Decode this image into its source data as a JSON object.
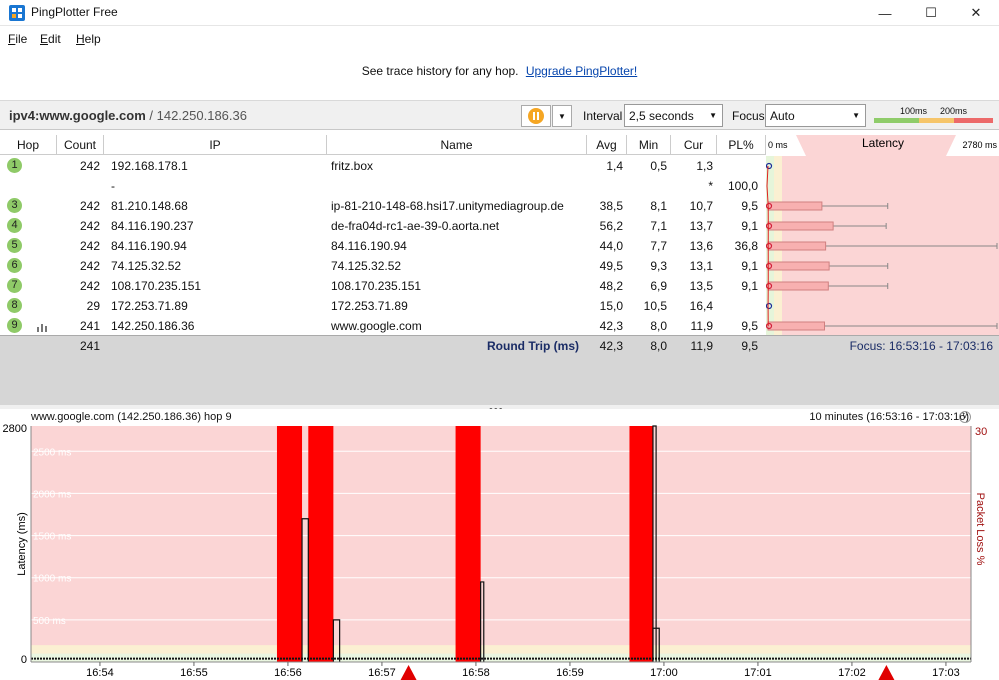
{
  "window": {
    "title": "PingPlotter Free",
    "minimize_glyph": "—",
    "maximize_glyph": "☐",
    "close_glyph": "✕"
  },
  "menu": {
    "file_hotkey": "F",
    "file_rest": "ile",
    "edit_hotkey": "E",
    "edit_rest": "dit",
    "help_hotkey": "H",
    "help_rest": "elp"
  },
  "promo": {
    "text": "See trace history for any hop.",
    "link": "Upgrade PingPlotter!"
  },
  "target": {
    "host": "ipv4:www.google.com",
    "separator": " / ",
    "ip": "142.250.186.36"
  },
  "controls": {
    "interval_label": "Interval",
    "interval_value": "2,5 seconds",
    "focus_label": "Focus",
    "focus_value": "Auto",
    "scale_100": "100ms",
    "scale_200": "200ms"
  },
  "colors": {
    "good": "#8fcc6a",
    "warn": "#f6c56a",
    "bad": "#ec6a6a",
    "latency_bg": "#fbd5d5",
    "loss_red": "#ff0000",
    "hop_green": "#8fca68"
  },
  "table": {
    "headers": [
      "Hop",
      "Count",
      "IP",
      "Name",
      "Avg",
      "Min",
      "Cur",
      "PL%"
    ],
    "latency_header": "Latency",
    "latency_min": "0 ms",
    "latency_max": "2780 ms",
    "rows": [
      {
        "hop": "1",
        "count": "242",
        "ip": "192.168.178.1",
        "name": "fritz.box",
        "avg": "1,4",
        "min": "0,5",
        "cur": "1,3",
        "pl": "",
        "box_avg": 1.4,
        "box_min": 0.5,
        "box_max": 1.4,
        "loss": 0
      },
      {
        "hop": "",
        "count": "",
        "ip": "-",
        "name": "",
        "avg": "",
        "min": "",
        "cur": "*",
        "pl": "100,0",
        "box_avg": null,
        "box_min": null,
        "box_max": null,
        "loss": 100
      },
      {
        "hop": "3",
        "count": "242",
        "ip": "81.210.148.68",
        "name": "ip-81-210-148-68.hsi17.unitymediagroup.de",
        "avg": "38,5",
        "min": "8,1",
        "cur": "10,7",
        "pl": "9,5",
        "box_avg": 38.5,
        "box_min": 8.1,
        "box_max": 760,
        "loss": 9.5
      },
      {
        "hop": "4",
        "count": "242",
        "ip": "84.116.190.237",
        "name": "de-fra04d-rc1-ae-39-0.aorta.net",
        "avg": "56,2",
        "min": "7,1",
        "cur": "13,7",
        "pl": "9,1",
        "box_avg": 56.2,
        "box_min": 7.1,
        "box_max": 740,
        "loss": 9.1
      },
      {
        "hop": "5",
        "count": "242",
        "ip": "84.116.190.94",
        "name": "84.116.190.94",
        "avg": "44,0",
        "min": "7,7",
        "cur": "13,6",
        "pl": "36,8",
        "box_avg": 44.0,
        "box_min": 7.7,
        "box_max": 2780,
        "loss": 36.8
      },
      {
        "hop": "6",
        "count": "242",
        "ip": "74.125.32.52",
        "name": "74.125.32.52",
        "avg": "49,5",
        "min": "9,3",
        "cur": "13,1",
        "pl": "9,1",
        "box_avg": 49.5,
        "box_min": 9.3,
        "box_max": 760,
        "loss": 9.1
      },
      {
        "hop": "7",
        "count": "242",
        "ip": "108.170.235.151",
        "name": "108.170.235.151",
        "avg": "48,2",
        "min": "6,9",
        "cur": "13,5",
        "pl": "9,1",
        "box_avg": 48.2,
        "box_min": 6.9,
        "box_max": 760,
        "loss": 9.1
      },
      {
        "hop": "8",
        "count": "29",
        "ip": "172.253.71.89",
        "name": "172.253.71.89",
        "avg": "15,0",
        "min": "10,5",
        "cur": "16,4",
        "pl": "",
        "box_avg": 15.0,
        "box_min": 10.5,
        "box_max": 16.4,
        "loss": 0
      },
      {
        "hop": "9",
        "count": "241",
        "ip": "142.250.186.36",
        "name": "www.google.com",
        "avg": "42,3",
        "min": "8,0",
        "cur": "11,9",
        "pl": "9,5",
        "box_avg": 42.3,
        "box_min": 8.0,
        "box_max": 2780,
        "loss": 9.5
      }
    ],
    "summary": {
      "count": "241",
      "label": "Round Trip (ms)",
      "avg": "42,3",
      "min": "8,0",
      "cur": "11,9",
      "pl": "9,5",
      "focus": "Focus: 16:53:16 - 17:03:16"
    }
  },
  "timeline": {
    "title": "www.google.com (142.250.186.36) hop 9",
    "range": "10 minutes (16:53:16 - 17:03:16)",
    "y_axis_label": "Latency (ms)",
    "y2_axis_label": "Packet Loss %",
    "y_top": "2800",
    "y_zero": "0",
    "y2_top": "30",
    "grid_labels": [
      "2500 ms",
      "2000 ms",
      "1500 ms",
      "1000 ms",
      "500 ms"
    ],
    "x_ticks": [
      "16:54",
      "16:55",
      "16:56",
      "16:57",
      "16:58",
      "16:59",
      "17:00",
      "17:01",
      "17:02",
      "17:03"
    ],
    "chart_data": {
      "type": "area",
      "ylim": [
        0,
        2800
      ],
      "y2lim": [
        0,
        30
      ],
      "x_range": [
        "16:53:16",
        "17:03:16"
      ],
      "baseline_latency_ms": 40,
      "loss_bars": [
        {
          "start": "16:55:53",
          "end": "16:56:09"
        },
        {
          "start": "16:56:13",
          "end": "16:56:29"
        },
        {
          "start": "16:57:47",
          "end": "16:58:03"
        },
        {
          "start": "16:59:38",
          "end": "16:59:53"
        }
      ],
      "latency_spikes": [
        {
          "start": "16:56:09",
          "end": "16:56:13",
          "latency_ms": 1700
        },
        {
          "start": "16:56:29",
          "end": "16:56:33",
          "latency_ms": 500
        },
        {
          "start": "16:58:03",
          "end": "16:58:05",
          "latency_ms": 950
        },
        {
          "start": "16:59:53",
          "end": "16:59:57",
          "latency_ms": 400
        },
        {
          "start": "16:59:53",
          "end": "16:59:55",
          "latency_ms": 2800
        }
      ],
      "loss_markers": [
        "16:57:17",
        "17:02:22"
      ]
    }
  }
}
